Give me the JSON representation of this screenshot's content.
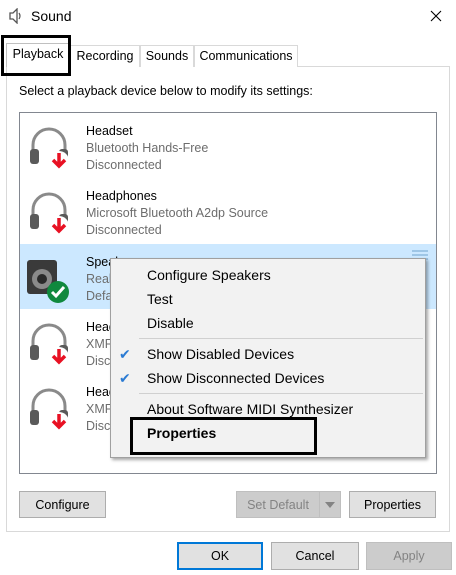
{
  "window": {
    "title": "Sound",
    "close_icon": "close-icon",
    "app_icon": "speaker-icon"
  },
  "tabs": [
    {
      "label": "Playback",
      "active": true
    },
    {
      "label": "Recording",
      "active": false
    },
    {
      "label": "Sounds",
      "active": false
    },
    {
      "label": "Communications",
      "active": false
    }
  ],
  "instruction": "Select a playback device below to modify its settings:",
  "devices": [
    {
      "name": "Headset",
      "line2": "Bluetooth Hands-Free",
      "line3": "Disconnected",
      "icon": "headset-icon",
      "status_icon": "down-arrow-red-icon"
    },
    {
      "name": "Headphones",
      "line2": "Microsoft Bluetooth A2dp Source",
      "line3": "Disconnected",
      "icon": "headphones-icon",
      "status_icon": "down-arrow-red-icon"
    },
    {
      "name": "Speak",
      "line2": "Real",
      "line3": "Defa",
      "icon": "speaker-icon",
      "status_icon": "green-check-icon",
      "selected": true
    },
    {
      "name": "Head",
      "line2": "XMF",
      "line3": "Disc",
      "icon": "headphones-icon",
      "status_icon": "down-arrow-red-icon"
    },
    {
      "name": "Head",
      "line2": "XMF",
      "line3": "Disc",
      "icon": "headphones-icon",
      "status_icon": "down-arrow-red-icon"
    }
  ],
  "context_menu": {
    "items": [
      {
        "label": "Configure Speakers",
        "checked": false
      },
      {
        "label": "Test",
        "checked": false
      },
      {
        "label": "Disable",
        "checked": false
      },
      {
        "label": "Show Disabled Devices",
        "checked": true
      },
      {
        "label": "Show Disconnected Devices",
        "checked": true
      },
      {
        "label": "About Software MIDI Synthesizer",
        "checked": false
      },
      {
        "label": "Properties",
        "checked": false,
        "bold": true
      }
    ]
  },
  "buttons": {
    "configure": "Configure",
    "set_default": "Set Default",
    "properties": "Properties",
    "ok": "OK",
    "cancel": "Cancel",
    "apply": "Apply"
  },
  "colors": {
    "selection": "#cce8ff",
    "accent": "#0078d7",
    "check": "#2b7bd3",
    "disconnected_arrow": "#e81123",
    "default_check": "#10893e"
  }
}
